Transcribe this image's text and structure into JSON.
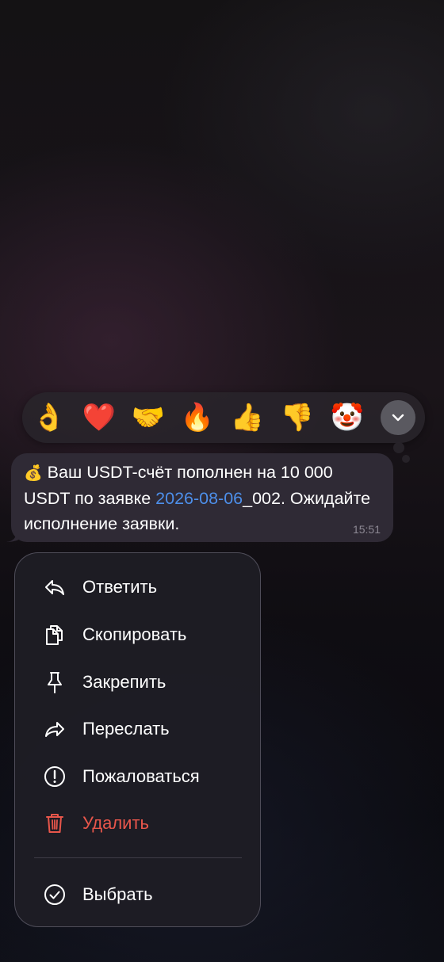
{
  "reactions": [
    {
      "emoji": "👌",
      "name": "ok-hand"
    },
    {
      "emoji": "❤️",
      "name": "red-heart"
    },
    {
      "emoji": "🤝",
      "name": "handshake"
    },
    {
      "emoji": "🔥",
      "name": "fire"
    },
    {
      "emoji": "👍",
      "name": "thumbs-up"
    },
    {
      "emoji": "👎",
      "name": "thumbs-down"
    },
    {
      "emoji": "🤡",
      "name": "clown-face"
    }
  ],
  "expand_icon": "chevron-down-icon",
  "message": {
    "emoji": "💰",
    "text_before_link": "Ваш USDT-счёт пополнен на 10 000 USDT по заявке ",
    "link_text": "2026-08-06",
    "text_after_link": "_002. Ожидайте исполнение заявки.",
    "time": "15:51"
  },
  "menu": {
    "items": [
      {
        "label": "Ответить",
        "icon": "reply-icon"
      },
      {
        "label": "Скопировать",
        "icon": "copy-icon"
      },
      {
        "label": "Закрепить",
        "icon": "pin-icon"
      },
      {
        "label": "Переслать",
        "icon": "forward-icon"
      },
      {
        "label": "Пожаловаться",
        "icon": "report-icon"
      },
      {
        "label": "Удалить",
        "icon": "trash-icon"
      },
      {
        "label": "Выбрать",
        "icon": "select-check-icon"
      }
    ]
  },
  "colors": {
    "link": "#4d8fea",
    "danger": "#e8564b",
    "bubble": "#2f2a35",
    "menu_bg": "#1e1d24"
  }
}
